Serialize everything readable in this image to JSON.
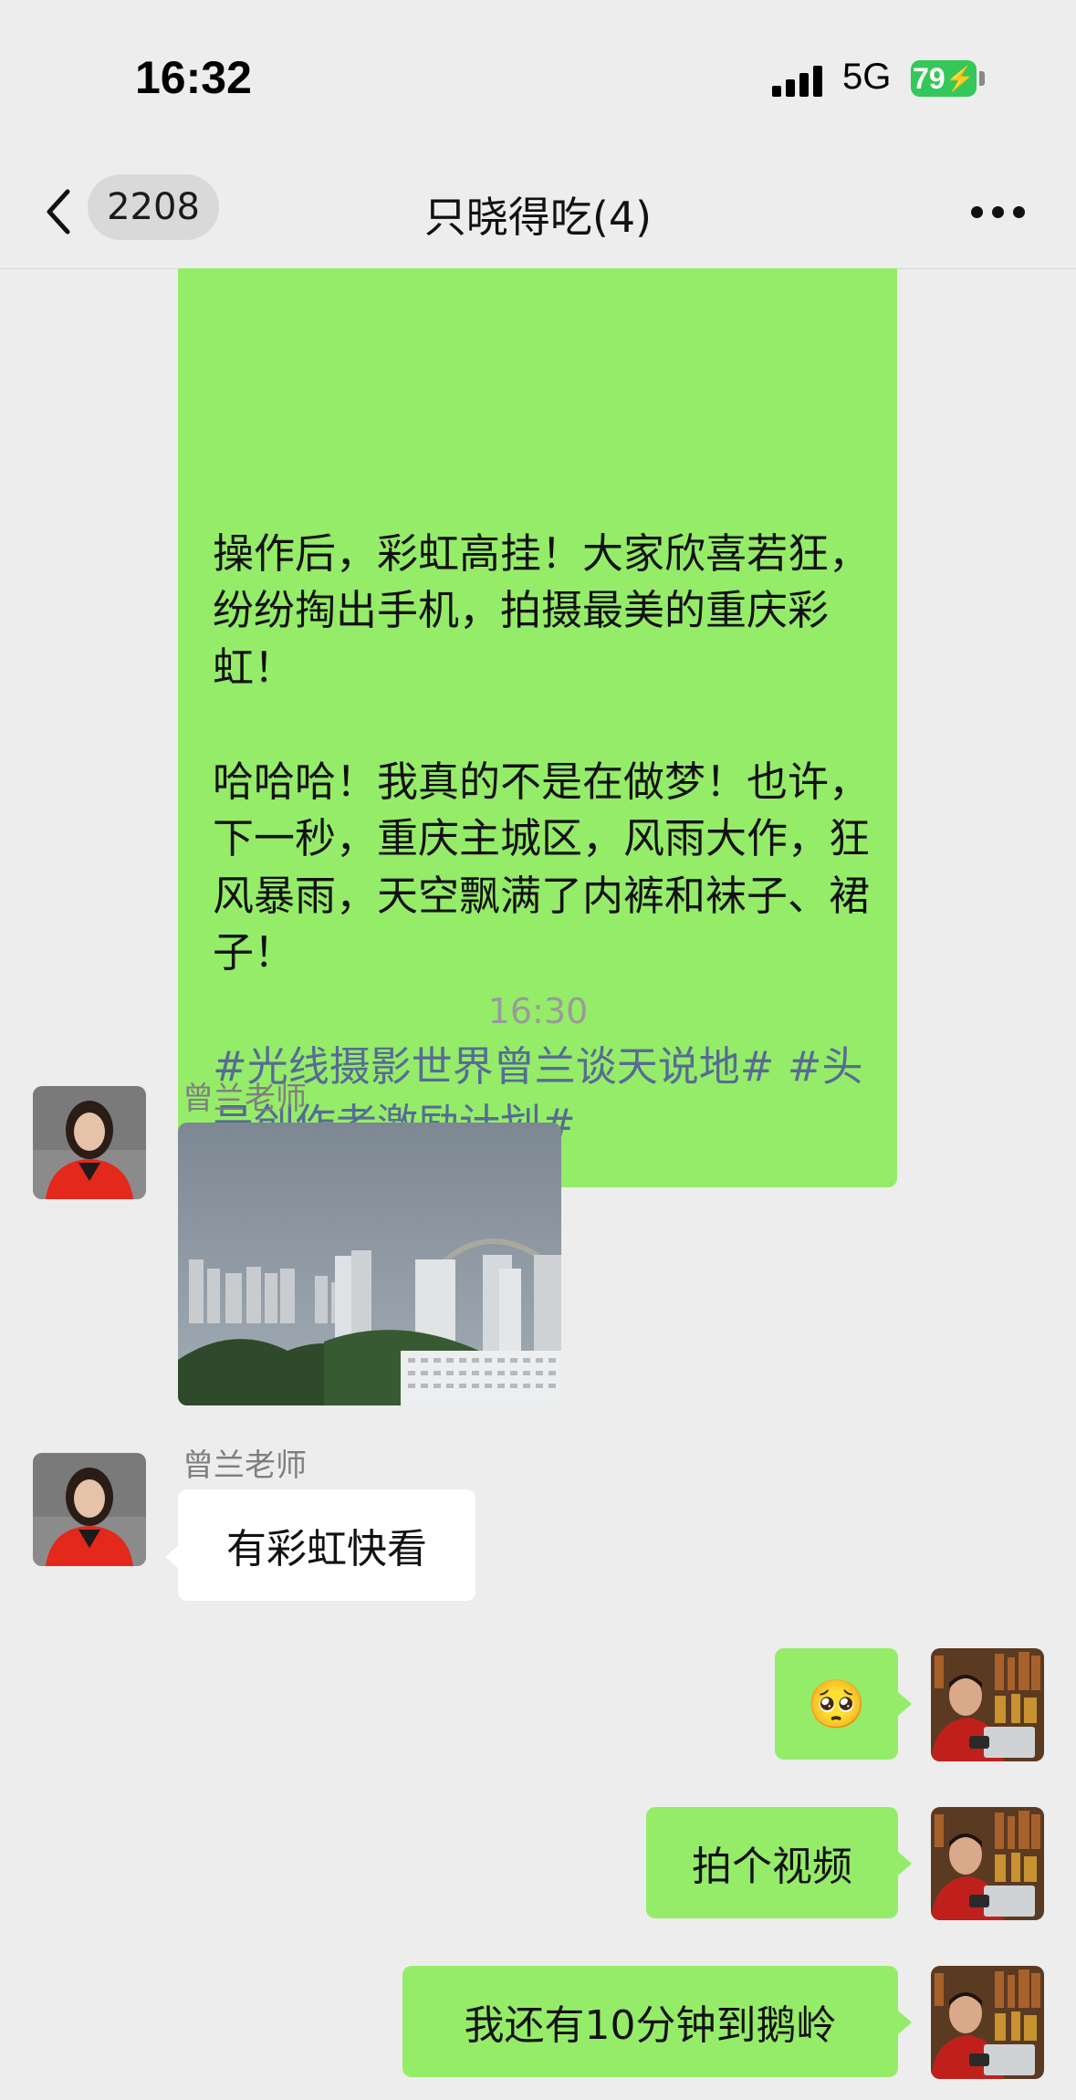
{
  "status_bar": {
    "time": "16:32",
    "network": "5G",
    "battery": "79"
  },
  "header": {
    "unread_count": "2208",
    "title": "只晓得吃(4)"
  },
  "messages": {
    "long_text_plain": "操作后，彩虹高挂！大家欣喜若狂，纷纷掏出手机，拍摄最美的重庆彩虹！\n\n哈哈哈！我真的不是在做梦！也许，下一秒，重庆主城区，风雨大作，狂风暴雨，天空飘满了内裤和袜子、裙子！\n\n",
    "hashtag_1": "#光线摄影世界曾兰谈天说地#",
    "hashtag_2": "#头号创作者激励计划#",
    "time_separator": "16:30",
    "sender_1": "曾兰老师",
    "sender_2": "曾兰老师",
    "text_1": "有彩虹快看",
    "emoji": "🥺",
    "text_2": "拍个视频",
    "text_3": "我还有10分钟到鹅岭"
  },
  "colors": {
    "background": "#ededed",
    "outgoing_bubble": "#95ec69",
    "incoming_bubble": "#ffffff",
    "hashtag": "#576b95",
    "battery": "#34c759"
  },
  "icons": [
    "back-arrow-icon",
    "more-icon",
    "signal-icon",
    "battery-icon"
  ]
}
